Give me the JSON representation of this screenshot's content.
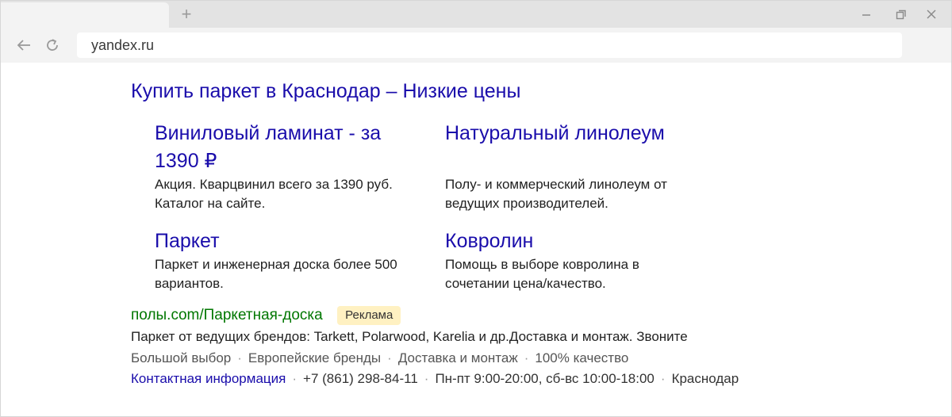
{
  "browser": {
    "new_tab_glyph": "+",
    "address": "yandex.ru",
    "icons": {
      "back": "back-arrow-icon",
      "reload": "reload-icon",
      "minimize": "minimize-icon",
      "restore": "restore-icon",
      "close": "close-icon"
    },
    "colors": {
      "tabstrip": "#e3e3e3",
      "toolbar": "#f3f3f3"
    }
  },
  "ad": {
    "title": "Купить паркет в Краснодар – Низкие цены",
    "sitelinks": [
      {
        "title": "Виниловый ламинат - за 1390 ₽",
        "desc": "Акция. Кварцвинил всего за 1390 руб. Каталог на сайте."
      },
      {
        "title": "Натуральный линолеум",
        "desc": "Полу- и коммерческий линолеум от ведущих производителей."
      },
      {
        "title": "Паркет",
        "desc": "Паркет и инженерная доска более 500 вариантов."
      },
      {
        "title": "Ковролин",
        "desc": "Помощь в выборе ковролина в сочетании цена/качество."
      }
    ],
    "url": "полы.com/Паркетная-доска",
    "badge": "Реклама",
    "description": "Паркет от ведущих брендов: Tarkett, Polarwood, Karelia и др.Доставка и монтаж. Звоните",
    "quick_links": [
      "Большой выбор",
      "Европейские бренды",
      "Доставка и монтаж",
      "100% качество"
    ],
    "contact": {
      "link": "Контактная информация",
      "phone": "+7 (861) 298-84-11",
      "hours": "Пн-пт 9:00-20:00, сб-вс 10:00-18:00",
      "city": "Краснодар"
    },
    "colors": {
      "link": "#1a0dab",
      "url": "#007700",
      "badge_bg": "#fff1c2"
    }
  }
}
